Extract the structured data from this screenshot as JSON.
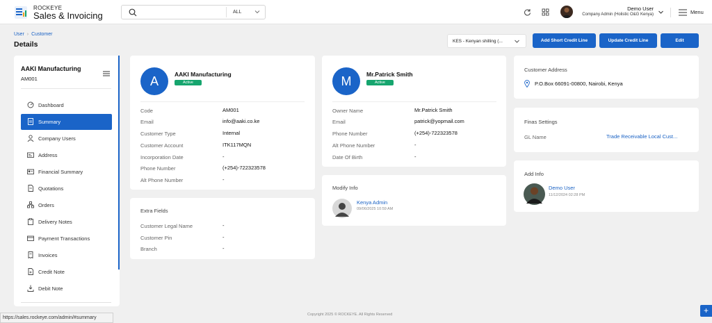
{
  "brand": {
    "top": "ROCKEYE",
    "main": "Sales & Invoicing"
  },
  "search": {
    "placeholder": "",
    "filter": "ALL"
  },
  "user": {
    "name": "Demo User",
    "role": "Company Admin (Holistic O&G Kenya)"
  },
  "menu": {
    "label": "Menu"
  },
  "breadcrumb": {
    "parent": "User",
    "current": "Customer"
  },
  "page": {
    "title": "Details"
  },
  "currency": {
    "selected": "KES - Kenyan shilling (..."
  },
  "actions": {
    "short_credit": "Add Short Credit Line",
    "update_credit": "Update Credit Line",
    "edit": "Edit"
  },
  "sidebar": {
    "company": "AAKI Manufacturing",
    "code": "AM001",
    "items": [
      {
        "label": "Dashboard",
        "icon": "dashboard-icon"
      },
      {
        "label": "Summary",
        "icon": "document-icon",
        "active": true
      },
      {
        "label": "Company Users",
        "icon": "user-icon"
      },
      {
        "label": "Address",
        "icon": "address-card-icon"
      },
      {
        "label": "Financial Summary",
        "icon": "id-card-icon"
      },
      {
        "label": "Quotations",
        "icon": "file-icon"
      },
      {
        "label": "Orders",
        "icon": "orders-icon"
      },
      {
        "label": "Delivery Notes",
        "icon": "clipboard-icon"
      },
      {
        "label": "Payment Transactions",
        "icon": "card-icon"
      },
      {
        "label": "Invoices",
        "icon": "invoice-icon"
      },
      {
        "label": "Credit Note",
        "icon": "credit-note-icon"
      },
      {
        "label": "Debit Note",
        "icon": "debit-note-icon"
      }
    ]
  },
  "customer": {
    "initial": "A",
    "name": "AAKI Manufacturing",
    "status": "Active",
    "rows": [
      {
        "label": "Code",
        "value": "AM001"
      },
      {
        "label": "Email",
        "value": "info@aaki.co.ke"
      },
      {
        "label": "Customer Type",
        "value": "Internal"
      },
      {
        "label": "Customer Account",
        "value": "ITK117MQN"
      },
      {
        "label": "Incorporation Date",
        "value": "-"
      },
      {
        "label": "Phone Number",
        "value": "(+254)-722323578"
      },
      {
        "label": "Alt Phone Number",
        "value": "-"
      }
    ]
  },
  "extra": {
    "title": "Extra Fields",
    "rows": [
      {
        "label": "Customer Legal Name",
        "value": "-"
      },
      {
        "label": "Customer Pin",
        "value": "-"
      },
      {
        "label": "Branch",
        "value": "-"
      }
    ]
  },
  "owner": {
    "initial": "M",
    "name": "Mr.Patrick Smith",
    "status": "Active",
    "rows": [
      {
        "label": "Owner Name",
        "value": "Mr.Patrick Smith"
      },
      {
        "label": "Email",
        "value": "patrick@yopmail.com"
      },
      {
        "label": "Phone Number",
        "value": "(+254)-722323578"
      },
      {
        "label": "Alt Phone Number",
        "value": "-"
      },
      {
        "label": "Date Of Birth",
        "value": "-"
      }
    ]
  },
  "modify": {
    "title": "Modify Info",
    "user": "Kenya Admin",
    "date": "09/06/2025 10:59 AM"
  },
  "address": {
    "title": "Customer Address",
    "value": "P.O.Box 66091-00800, Nairobi, Kenya"
  },
  "finas": {
    "title": "Finas Settings",
    "label": "GL Name",
    "value": "Trade Receivable Local Cust..."
  },
  "add_info": {
    "title": "Add Info",
    "user": "Demo User",
    "date": "11/12/2024 02:28 PM"
  },
  "footer": {
    "copyright": "Copyright 2025 © ROCKEYE. All Rights Reserved"
  },
  "status_bar": {
    "url": "https://sales.rockeye.com/admin/#summary"
  },
  "colors": {
    "primary": "#1a64c8",
    "success": "#16a56e"
  }
}
